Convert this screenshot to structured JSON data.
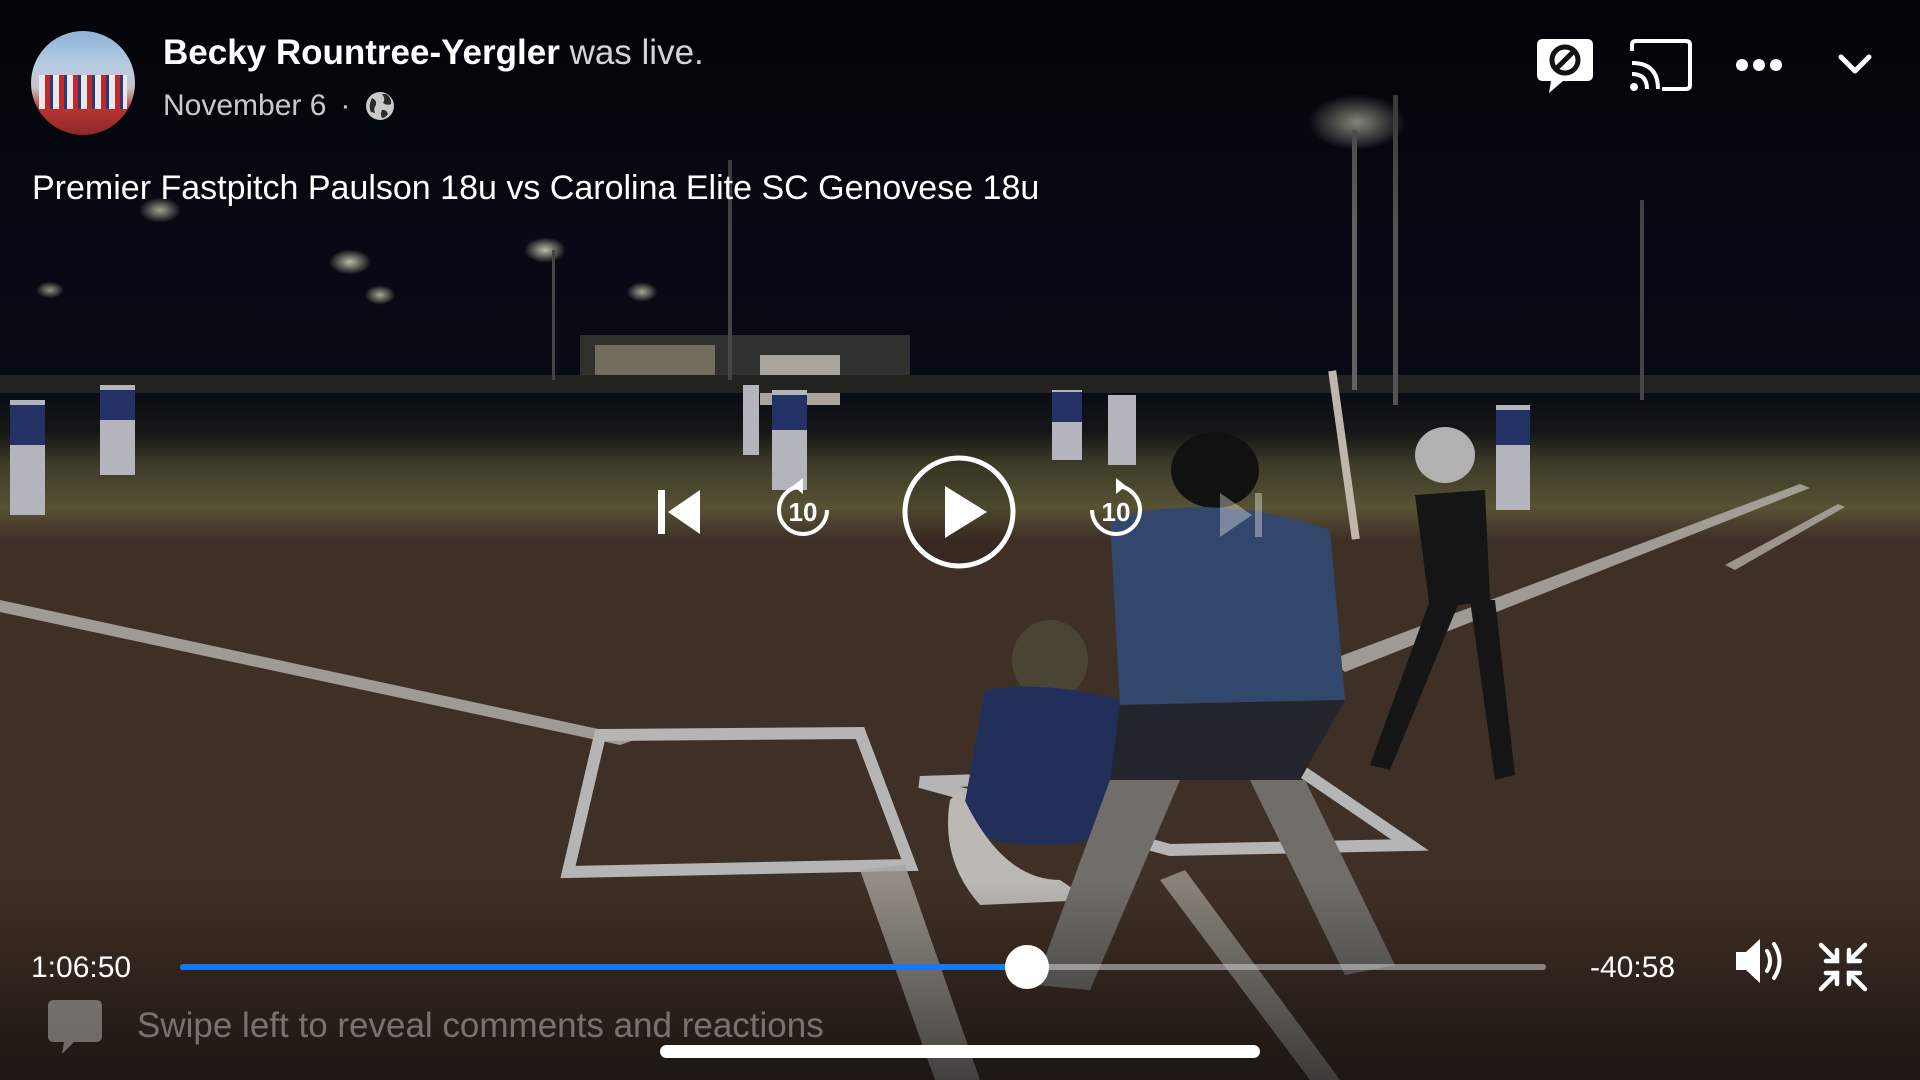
{
  "post": {
    "author": "Becky Rountree-Yergler",
    "status": "was live.",
    "date": "November 6",
    "separator": "·",
    "privacy_icon": "globe-icon",
    "video_title": "Premier Fastpitch Paulson 18u vs Carolina Elite SC Genovese 18u"
  },
  "top_controls": {
    "icons": [
      "comments-off-icon",
      "cast-icon",
      "more-options-icon",
      "chevron-down-icon"
    ]
  },
  "center_controls": {
    "icons": [
      "skip-previous-icon",
      "rewind-10-icon",
      "play-icon",
      "forward-10-icon",
      "skip-next-icon"
    ],
    "rewind_seconds": "10",
    "forward_seconds": "10"
  },
  "playback": {
    "elapsed": "1:06:50",
    "remaining": "-40:58",
    "progress_fraction": 0.62,
    "accent_color": "#1877f2"
  },
  "bottom_controls": {
    "icons": [
      "volume-icon",
      "exit-fullscreen-icon"
    ]
  },
  "comments": {
    "hint": "Swipe left to reveal comments and reactions",
    "icon": "chat-bubble-icon"
  }
}
